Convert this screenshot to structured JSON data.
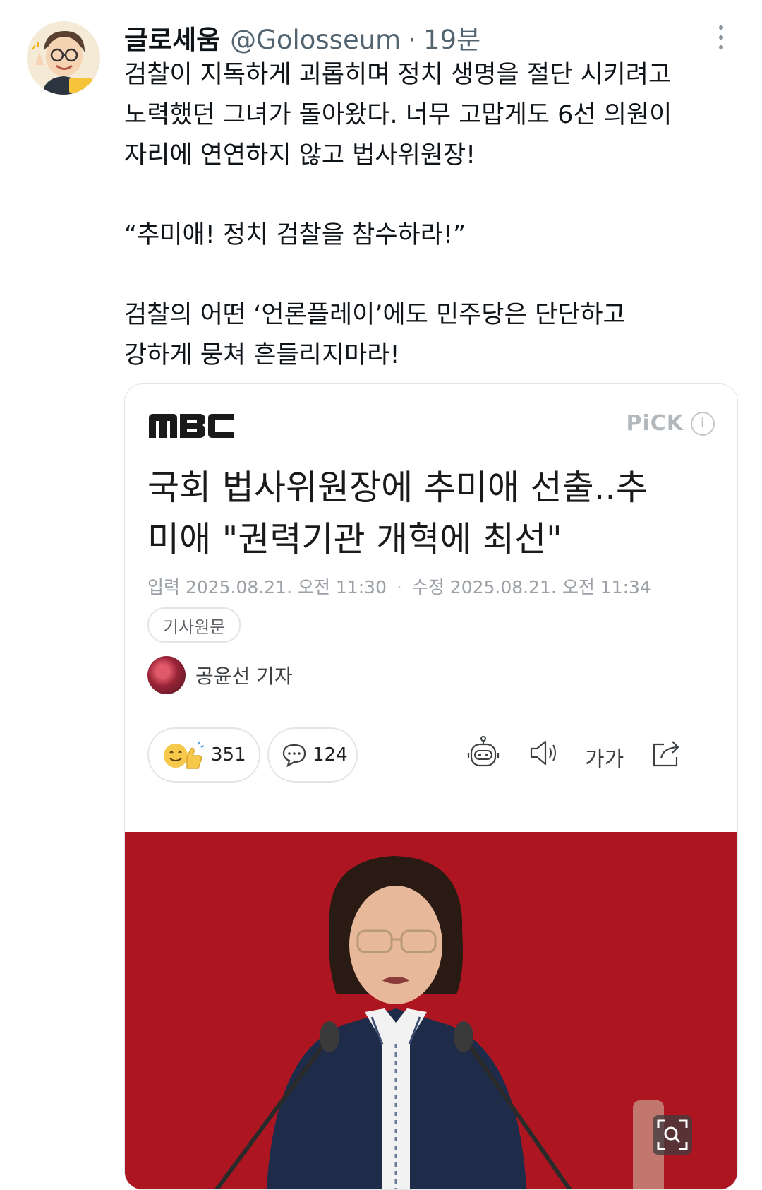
{
  "tweet": {
    "display_name": "글로세움",
    "handle": "@Golosseum",
    "separator": "·",
    "time": "19분",
    "lines": [
      "검찰이 지독하게 괴롭히며 정치 생명을 절단 시키려고",
      "노력했던 그녀가 돌아왔다. 너무 고맙게도 6선 의원이",
      "자리에 연연하지 않고 법사위원장!",
      "“추미애! 정치 검찰을 참수하라!”",
      "검찰의 어떤 ‘언론플레이’에도 민주당은 단단하고",
      "강하게 뭉쳐 흔들리지마라!"
    ]
  },
  "card": {
    "logo": "MBC",
    "pick_label": "PiCK",
    "info_icon": "i",
    "headline_lines": [
      "국회 법사위원장에 추미애 선출..추",
      "미애 \"권력기관 개혁에 최선\""
    ],
    "published": "입력 2025.08.21. 오전 11:30",
    "date_separator": "·",
    "modified": "수정 2025.08.21. 오전 11:34",
    "source_chip": "기사원문",
    "reporter": "공윤선 기자",
    "like_count": "351",
    "comment_count": "124",
    "font_size_label": "가가"
  },
  "icons": {
    "more": "more-vertical-icon",
    "like": "like-emoji-icon",
    "comment": "comment-bubble-icon",
    "robot": "robot-summary-icon",
    "speaker": "speaker-icon",
    "share": "share-icon",
    "zoom": "zoom-search-icon"
  },
  "colors": {
    "text_primary": "#0f1419",
    "text_secondary": "#536471",
    "photo_background": "#a8141f"
  }
}
